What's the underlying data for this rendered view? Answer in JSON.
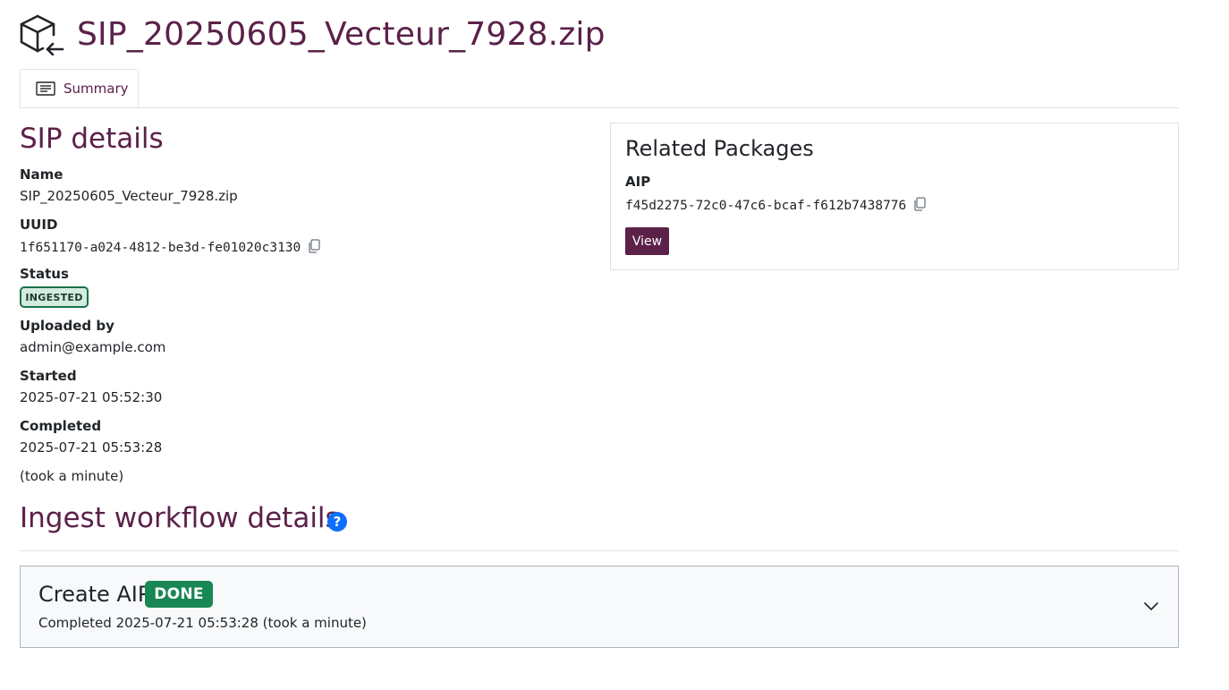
{
  "header": {
    "title": "SIP_20250605_Vecteur_7928.zip",
    "icon": "package-return-icon"
  },
  "tabs": [
    {
      "label": "Summary",
      "icon": "list-card-icon",
      "active": true
    }
  ],
  "sip_details": {
    "heading": "SIP details",
    "name_label": "Name",
    "name_value": "SIP_20250605_Vecteur_7928.zip",
    "uuid_label": "UUID",
    "uuid_value": "1f651170-a024-4812-be3d-fe01020c3130",
    "status_label": "Status",
    "status_value": "INGESTED",
    "uploaded_by_label": "Uploaded by",
    "uploaded_by_value": "admin@example.com",
    "started_label": "Started",
    "started_value": "2025-07-21 05:52:30",
    "completed_label": "Completed",
    "completed_value": "2025-07-21 05:53:28",
    "duration": "(took a minute)"
  },
  "related_packages": {
    "heading": "Related Packages",
    "aip_label": "AIP",
    "aip_uuid": "f45d2275-72c0-47c6-bcaf-f612b7438776",
    "view_label": "View"
  },
  "workflow": {
    "heading": "Ingest workflow details",
    "help_glyph": "?",
    "steps": [
      {
        "title": "Create AIP",
        "status": "DONE",
        "detail": "Completed 2025-07-21 05:53:28 (took a minute)"
      }
    ]
  },
  "colors": {
    "brand": "#5b2149",
    "success": "#198754",
    "success_light": "#d4ebdf",
    "info": "#0d6efd",
    "border": "#dee2e6"
  }
}
